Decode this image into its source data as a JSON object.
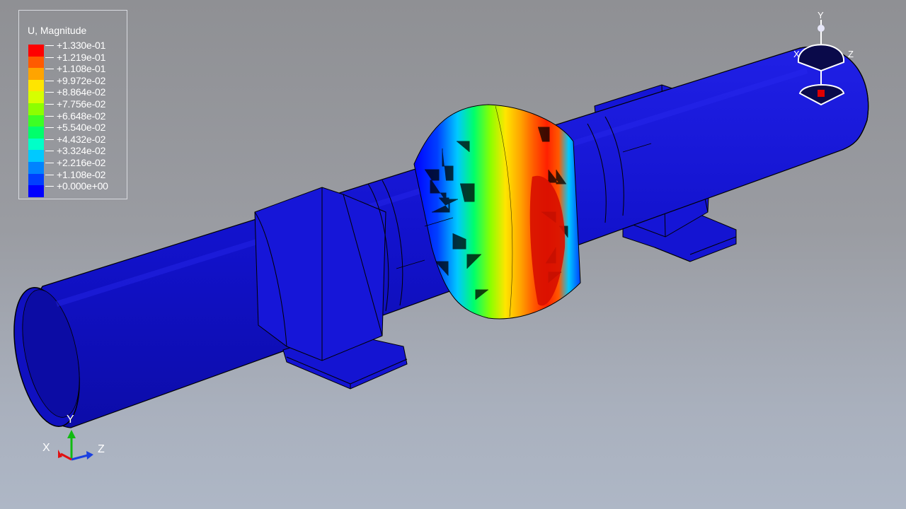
{
  "legend": {
    "title": "U, Magnitude",
    "entries": [
      {
        "label": "+1.330e-01",
        "color": "#ff0000"
      },
      {
        "label": "+1.219e-01",
        "color": "#ff5a00"
      },
      {
        "label": "+1.108e-01",
        "color": "#ffa400"
      },
      {
        "label": "+9.972e-02",
        "color": "#ffe500"
      },
      {
        "label": "+8.864e-02",
        "color": "#d6ff00"
      },
      {
        "label": "+7.756e-02",
        "color": "#8cff00"
      },
      {
        "label": "+6.648e-02",
        "color": "#3cff24"
      },
      {
        "label": "+5.540e-02",
        "color": "#00ff6b"
      },
      {
        "label": "+4.432e-02",
        "color": "#00ffc8"
      },
      {
        "label": "+3.324e-02",
        "color": "#00c9ff"
      },
      {
        "label": "+2.216e-02",
        "color": "#0083ff"
      },
      {
        "label": "+1.108e-02",
        "color": "#003fff"
      },
      {
        "label": "+0.000e+00",
        "color": "#0000ff"
      }
    ]
  },
  "triad": {
    "y": "Y",
    "x": "X",
    "z": "Z"
  },
  "view_cube": {
    "y": "Y",
    "x": "X",
    "z": "Z"
  },
  "colors": {
    "pipe": "#1414d2",
    "pipe_dark": "#0a0a9c",
    "pipe_light": "#2525e8"
  }
}
